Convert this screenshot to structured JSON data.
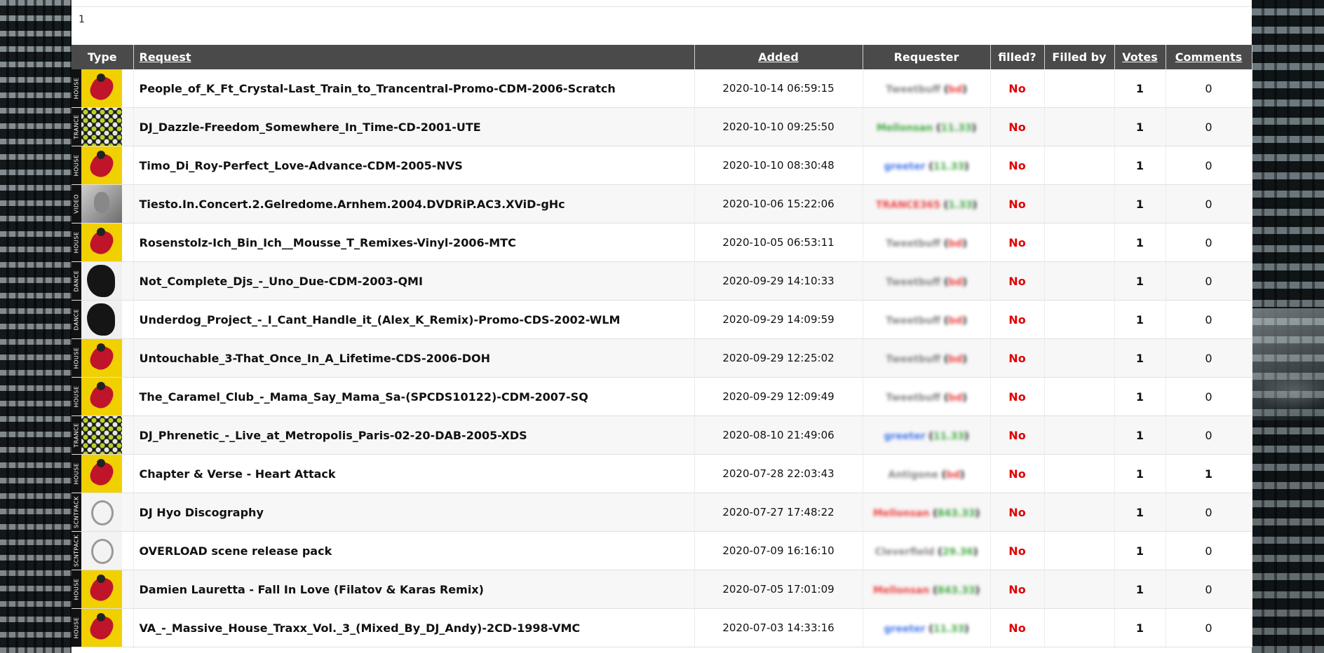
{
  "page_number": "1",
  "columns": {
    "type": "Type",
    "request": "Request",
    "added": "Added",
    "requester": "Requester",
    "filled": "filled?",
    "filled_by": "Filled by",
    "votes": "Votes",
    "comments": "Comments"
  },
  "rows": [
    {
      "type": "HOUSE",
      "art": "house",
      "request": "People_of_K_Ft_Crystal-Last_Train_to_Trancentral-Promo-CDM-2006-Scratch",
      "added": "2020-10-14 06:59:15",
      "requester": "Tweetbuff",
      "req_tag": "bd",
      "req_color": "#888888",
      "tag_color": "#ee4444",
      "filled": "No",
      "filled_by": "",
      "votes": "1",
      "comments": "0"
    },
    {
      "type": "TRANCE",
      "art": "trance",
      "request": "DJ_Dazzle-Freedom_Somewhere_In_Time-CD-2001-UTE",
      "added": "2020-10-10 09:25:50",
      "requester": "Mellonsan",
      "req_tag": "11.33",
      "req_color": "#44aa44",
      "tag_color": "#44aa44",
      "filled": "No",
      "filled_by": "",
      "votes": "1",
      "comments": "0"
    },
    {
      "type": "HOUSE",
      "art": "house",
      "request": "Timo_Di_Roy-Perfect_Love-Advance-CDM-2005-NVS",
      "added": "2020-10-10 08:30:48",
      "requester": "greeter",
      "req_tag": "11.33",
      "req_color": "#4477ee",
      "tag_color": "#44aa44",
      "filled": "No",
      "filled_by": "",
      "votes": "1",
      "comments": "0"
    },
    {
      "type": "VIDEO",
      "art": "video",
      "request": "Tiesto.In.Concert.2.Gelredome.Arnhem.2004.DVDRiP.AC3.XViD-gHc",
      "added": "2020-10-06 15:22:06",
      "requester": "TRANCE365",
      "req_tag": "1.33",
      "req_color": "#ee4444",
      "tag_color": "#44aa44",
      "filled": "No",
      "filled_by": "",
      "votes": "1",
      "comments": "0"
    },
    {
      "type": "HOUSE",
      "art": "house",
      "request": "Rosenstolz-Ich_Bin_Ich__Mousse_T_Remixes-Vinyl-2006-MTC",
      "added": "2020-10-05 06:53:11",
      "requester": "Tweetbuff",
      "req_tag": "bd",
      "req_color": "#888888",
      "tag_color": "#ee4444",
      "filled": "No",
      "filled_by": "",
      "votes": "1",
      "comments": "0"
    },
    {
      "type": "DANCE",
      "art": "dance",
      "request": "Not_Complete_Djs_-_Uno_Due-CDM-2003-QMI",
      "added": "2020-09-29 14:10:33",
      "requester": "Tweetbuff",
      "req_tag": "bd",
      "req_color": "#888888",
      "tag_color": "#ee4444",
      "filled": "No",
      "filled_by": "",
      "votes": "1",
      "comments": "0"
    },
    {
      "type": "DANCE",
      "art": "dance",
      "request": "Underdog_Project_-_I_Cant_Handle_it_(Alex_K_Remix)-Promo-CDS-2002-WLM",
      "added": "2020-09-29 14:09:59",
      "requester": "Tweetbuff",
      "req_tag": "bd",
      "req_color": "#888888",
      "tag_color": "#ee4444",
      "filled": "No",
      "filled_by": "",
      "votes": "1",
      "comments": "0"
    },
    {
      "type": "HOUSE",
      "art": "house",
      "request": "Untouchable_3-That_Once_In_A_Lifetime-CDS-2006-DOH",
      "added": "2020-09-29 12:25:02",
      "requester": "Tweetbuff",
      "req_tag": "bd",
      "req_color": "#888888",
      "tag_color": "#ee4444",
      "filled": "No",
      "filled_by": "",
      "votes": "1",
      "comments": "0"
    },
    {
      "type": "HOUSE",
      "art": "house",
      "request": "The_Caramel_Club_-_Mama_Say_Mama_Sa-(SPCDS10122)-CDM-2007-SQ",
      "added": "2020-09-29 12:09:49",
      "requester": "Tweetbuff",
      "req_tag": "bd",
      "req_color": "#888888",
      "tag_color": "#ee4444",
      "filled": "No",
      "filled_by": "",
      "votes": "1",
      "comments": "0"
    },
    {
      "type": "TRANCE",
      "art": "trance",
      "request": "DJ_Phrenetic_-_Live_at_Metropolis_Paris-02-20-DAB-2005-XDS",
      "added": "2020-08-10 21:49:06",
      "requester": "greeter",
      "req_tag": "11.33",
      "req_color": "#4477ee",
      "tag_color": "#44aa44",
      "filled": "No",
      "filled_by": "",
      "votes": "1",
      "comments": "0"
    },
    {
      "type": "HOUSE",
      "art": "house",
      "request": "Chapter & Verse - Heart Attack",
      "added": "2020-07-28 22:03:43",
      "requester": "Antigone",
      "req_tag": "bd",
      "req_color": "#888888",
      "tag_color": "#ee4444",
      "filled": "No",
      "filled_by": "",
      "votes": "1",
      "comments": "1"
    },
    {
      "type": "SCNTPACK",
      "art": "scntpack",
      "request": "DJ Hyo Discography",
      "added": "2020-07-27 17:48:22",
      "requester": "Mellonsan",
      "req_tag": "843.33",
      "req_color": "#ee4444",
      "tag_color": "#44aa44",
      "filled": "No",
      "filled_by": "",
      "votes": "1",
      "comments": "0"
    },
    {
      "type": "SCNTPACK",
      "art": "scntpack",
      "request": "OVERLOAD scene release pack",
      "added": "2020-07-09 16:16:10",
      "requester": "Cleverfield",
      "req_tag": "29.36",
      "req_color": "#888888",
      "tag_color": "#44aa44",
      "filled": "No",
      "filled_by": "",
      "votes": "1",
      "comments": "0"
    },
    {
      "type": "HOUSE",
      "art": "house",
      "request": "Damien Lauretta - Fall In Love (Filatov & Karas Remix)",
      "added": "2020-07-05 17:01:09",
      "requester": "Mellonsan",
      "req_tag": "843.33",
      "req_color": "#ee4444",
      "tag_color": "#44aa44",
      "filled": "No",
      "filled_by": "",
      "votes": "1",
      "comments": "0"
    },
    {
      "type": "HOUSE",
      "art": "house",
      "request": "VA_-_Massive_House_Traxx_Vol._3_(Mixed_By_DJ_Andy)-2CD-1998-VMC",
      "added": "2020-07-03 14:33:16",
      "requester": "greeter",
      "req_tag": "11.33",
      "req_color": "#4477ee",
      "tag_color": "#44aa44",
      "filled": "No",
      "filled_by": "",
      "votes": "1",
      "comments": "0"
    }
  ]
}
